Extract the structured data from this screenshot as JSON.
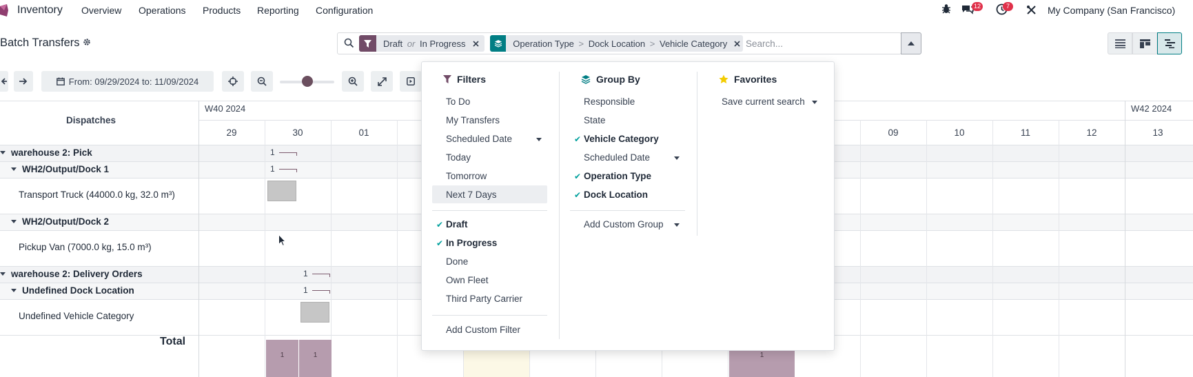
{
  "navbar": {
    "app_name": "Inventory",
    "menus": [
      "Overview",
      "Operations",
      "Products",
      "Reporting",
      "Configuration"
    ],
    "messages_count": "12",
    "activities_count": "7",
    "company": "My Company (San Francisco)"
  },
  "control_panel": {
    "title": "Batch Transfers",
    "facets": {
      "filter_a": "Draft",
      "filter_or": "or",
      "filter_b": "In Progress",
      "groupby_1": "Operation Type",
      "groupby_2": "Dock Location",
      "groupby_3": "Vehicle Category",
      "separator": ">"
    },
    "search_placeholder": "Search..."
  },
  "toolbar": {
    "date_range": "From: 09/29/2024 to: 11/09/2024",
    "zoom_level": 0.5
  },
  "gantt": {
    "header_label": "Dispatches",
    "weeks": [
      "W40 2024",
      "W42 2024"
    ],
    "days": [
      "29",
      "30",
      "01",
      "09",
      "10",
      "11",
      "12",
      "13"
    ],
    "rows": [
      {
        "label": "warehouse 2: Pick",
        "count": "1"
      },
      {
        "label": "WH2/Output/Dock 1",
        "count": "1"
      },
      {
        "label": "Transport Truck (44000.0 kg, 32.0 m³)"
      },
      {
        "label": "WH2/Output/Dock 2"
      },
      {
        "label": "Pickup Van (7000.0 kg, 15.0 m³)"
      },
      {
        "label": "warehouse 2: Delivery Orders",
        "count": "1"
      },
      {
        "label": "Undefined Dock Location",
        "count": "1"
      },
      {
        "label": "Undefined Vehicle Category"
      }
    ],
    "total_label": "Total",
    "totals": [
      "1",
      "1",
      "1"
    ]
  },
  "dropdown": {
    "filters_title": "Filters",
    "filters": [
      "To Do",
      "My Transfers",
      "Scheduled Date",
      "Today",
      "Tomorrow",
      "Next 7 Days",
      "Draft",
      "In Progress",
      "Done",
      "Own Fleet",
      "Third Party Carrier",
      "Add Custom Filter"
    ],
    "groupby_title": "Group By",
    "groupby": [
      "Responsible",
      "State",
      "Vehicle Category",
      "Scheduled Date",
      "Operation Type",
      "Dock Location",
      "Add Custom Group"
    ],
    "favorites_title": "Favorites",
    "favorites": [
      "Save current search"
    ]
  },
  "colors": {
    "accent": "#714b67",
    "groupby_accent": "#017e84",
    "check": "#00a09d",
    "badge": "#e0314a",
    "bar_total": "#b69cae"
  }
}
